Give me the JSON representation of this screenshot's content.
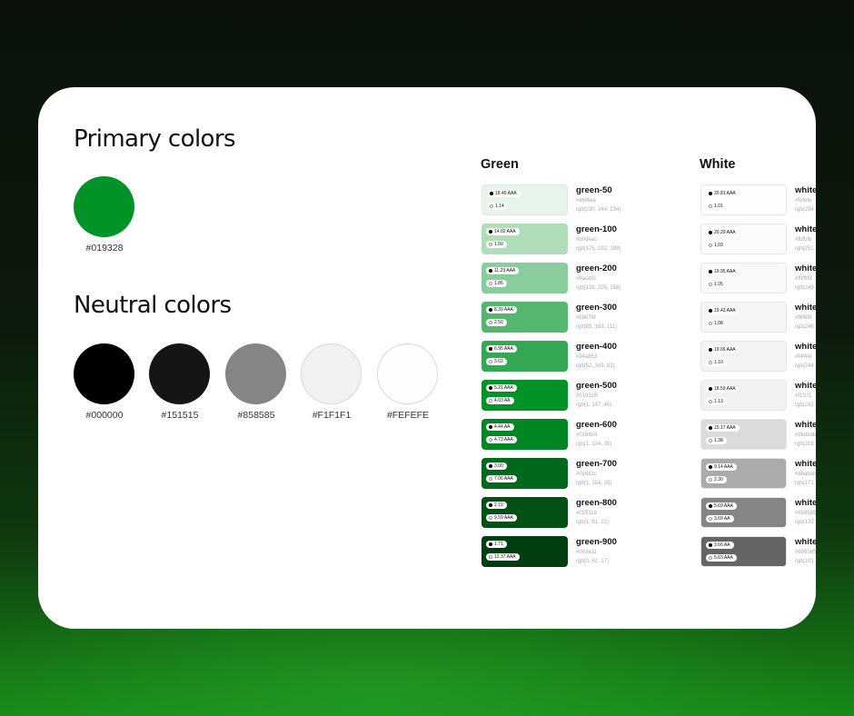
{
  "primary": {
    "title": "Primary colors",
    "swatches": [
      {
        "hex": "#019328",
        "label": "#019328"
      }
    ]
  },
  "neutral": {
    "title": "Neutral colors",
    "swatches": [
      {
        "hex": "#000000",
        "label": "#000000"
      },
      {
        "hex": "#151515",
        "label": "#151515"
      },
      {
        "hex": "#858585",
        "label": "#858585"
      },
      {
        "hex": "#F1F1F1",
        "label": "#F1F1F1"
      },
      {
        "hex": "#FEFEFE",
        "label": "#FEFEFE"
      }
    ]
  },
  "palettes": [
    {
      "title": "Green",
      "shades": [
        {
          "name": "green-50",
          "hex_text": "#e6f4ea",
          "rgb_text": "rgb(230, 244, 234)",
          "color": "#e6f4ea",
          "contrast_black": "18.49 AAA",
          "contrast_white": "1.14"
        },
        {
          "name": "green-100",
          "hex_text": "#b0deac",
          "rgb_text": "rgb(176, 222, 188)",
          "color": "#b0deb9",
          "contrast_black": "14.02 AAA",
          "contrast_white": "1.50"
        },
        {
          "name": "green-200",
          "hex_text": "#8acd9c",
          "rgb_text": "rgb(138, 205, 156)",
          "color": "#8acd9c",
          "contrast_black": "11.29 AAA",
          "contrast_white": "1.86"
        },
        {
          "name": "green-300",
          "hex_text": "#55b76f",
          "rgb_text": "rgb(85, 183, 111)",
          "color": "#55b76f",
          "contrast_black": "8.39 AAA",
          "contrast_white": "2.50"
        },
        {
          "name": "green-400",
          "hex_text": "#34a853",
          "rgb_text": "rgb(52, 169, 83)",
          "color": "#34a853",
          "contrast_black": "6.95 AAA",
          "contrast_white": "3.02"
        },
        {
          "name": "green-500",
          "hex_text": "#01932B",
          "rgb_text": "rgb(1, 147, 40)",
          "color": "#019328",
          "contrast_black": "5.21 AAA",
          "contrast_white": "4.03 AA"
        },
        {
          "name": "green-600",
          "hex_text": "#018624",
          "rgb_text": "rgb(1, 134, 36)",
          "color": "#018624",
          "contrast_black": "4.44 AA",
          "contrast_white": "4.73 AAA"
        },
        {
          "name": "green-700",
          "hex_text": "#01681c",
          "rgb_text": "rgb(1, 104, 28)",
          "color": "#01681c",
          "contrast_black": "3.00",
          "contrast_white": "7.06 AAA"
        },
        {
          "name": "green-800",
          "hex_text": "#015118",
          "rgb_text": "rgb(1, 81, 22)",
          "color": "#015116",
          "contrast_black": "2.19",
          "contrast_white": "9.59 AAA"
        },
        {
          "name": "green-900",
          "hex_text": "#003e11",
          "rgb_text": "rgb(0, 62, 17)",
          "color": "#003e11",
          "contrast_black": "1.71",
          "contrast_white": "12.37 AAA"
        }
      ]
    },
    {
      "title": "White",
      "shades": [
        {
          "name": "white",
          "hex_text": "#fefefe",
          "rgb_text": "rgb(254",
          "color": "#fefefe",
          "contrast_black": "20.81 AAA",
          "contrast_white": "1.01"
        },
        {
          "name": "white",
          "hex_text": "#fbfbfb",
          "rgb_text": "rgb(251",
          "color": "#fbfbfb",
          "contrast_black": "20.29 AAA",
          "contrast_white": "1.03"
        },
        {
          "name": "white",
          "hex_text": "#f9f9f9",
          "rgb_text": "rgb(249",
          "color": "#f9f9f9",
          "contrast_black": "19.95 AAA",
          "contrast_white": "1.05"
        },
        {
          "name": "white",
          "hex_text": "#f6f6f6",
          "rgb_text": "rgb(246",
          "color": "#f6f6f6",
          "contrast_black": "19.43 AAA",
          "contrast_white": "1.08"
        },
        {
          "name": "white",
          "hex_text": "#f4f4f4",
          "rgb_text": "rgb(244",
          "color": "#f4f4f4",
          "contrast_black": "19.09 AAA",
          "contrast_white": "1.10"
        },
        {
          "name": "white",
          "hex_text": "#f1f1f1",
          "rgb_text": "rgb(241",
          "color": "#f1f1f1",
          "contrast_black": "18.59 AAA",
          "contrast_white": "1.13"
        },
        {
          "name": "white",
          "hex_text": "#dbdbdb",
          "rgb_text": "rgb(219",
          "color": "#dbdbdb",
          "contrast_black": "15.17 AAA",
          "contrast_white": "1.38"
        },
        {
          "name": "white",
          "hex_text": "#ababab",
          "rgb_text": "rgb(171",
          "color": "#ababab",
          "contrast_black": "9.14 AAA",
          "contrast_white": "2.30"
        },
        {
          "name": "white",
          "hex_text": "#858585",
          "rgb_text": "rgb(133",
          "color": "#858585",
          "contrast_black": "5.69 AAA",
          "contrast_white": "3.69 AA"
        },
        {
          "name": "white",
          "hex_text": "#656565",
          "rgb_text": "rgb(101",
          "color": "#656565",
          "contrast_black": "3.66 AA",
          "contrast_white": "5.63 AAA"
        }
      ]
    }
  ]
}
